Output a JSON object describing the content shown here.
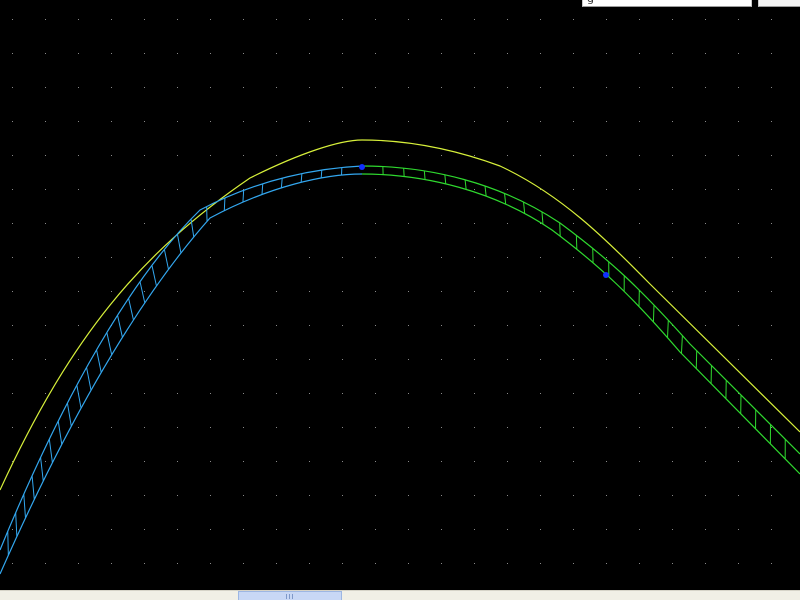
{
  "app": {
    "toolbar_partial_text": "g"
  },
  "canvas": {
    "background": "#000000",
    "grid_dot_color": "#8a8a8a",
    "offset_curve_color": "#d7f03a",
    "segment_a_color": "#33a7ef",
    "segment_b_color": "#2fd92f",
    "control_point_color": "#1030ff"
  },
  "scrollbar": {
    "visible_fraction": 0.13
  }
}
